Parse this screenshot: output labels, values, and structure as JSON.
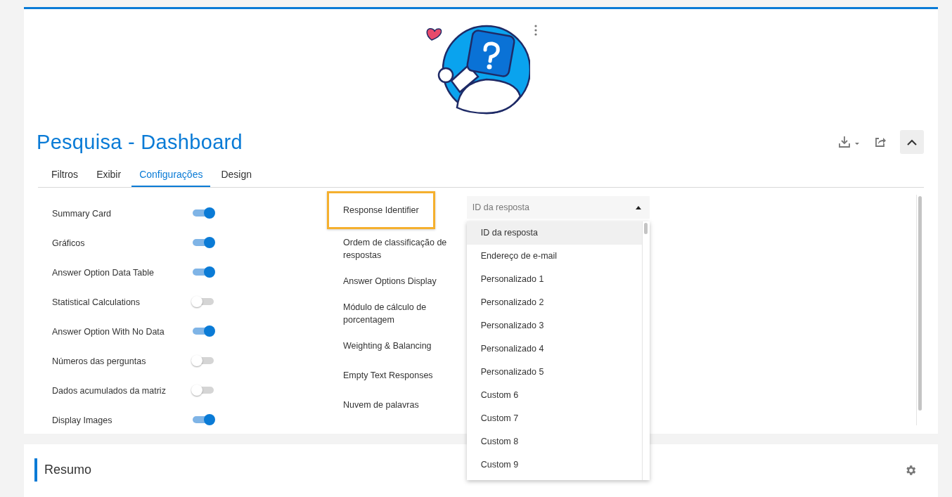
{
  "title": "Pesquisa - Dashboard",
  "tabs": [
    {
      "label": "Filtros",
      "selected": false
    },
    {
      "label": "Exibir",
      "selected": false
    },
    {
      "label": "Configurações",
      "selected": true
    },
    {
      "label": "Design",
      "selected": false
    }
  ],
  "left_settings": [
    {
      "label": "Summary Card",
      "on": true
    },
    {
      "label": "Gráficos",
      "on": true
    },
    {
      "label": "Answer Option Data Table",
      "on": true
    },
    {
      "label": "Statistical Calculations",
      "on": false
    },
    {
      "label": "Answer Option With No Data",
      "on": true
    },
    {
      "label": "Números das perguntas",
      "on": false
    },
    {
      "label": "Dados acumulados da matriz",
      "on": false
    },
    {
      "label": "Display Images",
      "on": true
    }
  ],
  "middle_settings": [
    {
      "label": "Response Identifier",
      "highlighted": true
    },
    {
      "label": "Ordem de classificação de respostas",
      "highlighted": false
    },
    {
      "label": "Answer Options Display",
      "highlighted": false
    },
    {
      "label": "Módulo de cálculo de porcentagem",
      "highlighted": false
    },
    {
      "label": "Weighting & Balancing",
      "highlighted": false
    },
    {
      "label": "Empty Text Responses",
      "highlighted": false
    },
    {
      "label": "Nuvem de palavras",
      "highlighted": false
    }
  ],
  "response_identifier_dropdown": {
    "value": "ID da resposta",
    "expanded": true,
    "options": [
      {
        "label": "ID da resposta",
        "selected": true
      },
      {
        "label": "Endereço de e-mail",
        "selected": false
      },
      {
        "label": "Personalizado 1",
        "selected": false
      },
      {
        "label": "Personalizado 2",
        "selected": false
      },
      {
        "label": "Personalizado 3",
        "selected": false
      },
      {
        "label": "Personalizado 4",
        "selected": false
      },
      {
        "label": "Personalizado 5",
        "selected": false
      },
      {
        "label": "Custom 6",
        "selected": false
      },
      {
        "label": "Custom 7",
        "selected": false
      },
      {
        "label": "Custom 8",
        "selected": false
      },
      {
        "label": "Custom 9",
        "selected": false
      }
    ]
  },
  "summary_section": {
    "title": "Resumo"
  }
}
